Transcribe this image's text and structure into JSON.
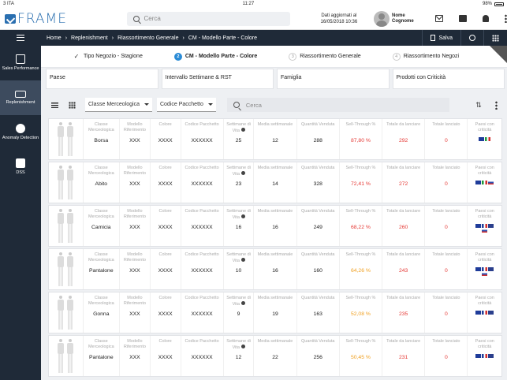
{
  "status": {
    "carrier": "3 ITA",
    "time": "11:27",
    "battery": "98%"
  },
  "header": {
    "logo": "FRAME",
    "search_placeholder": "Cerca",
    "updated_line1": "Dati aggiornati al",
    "updated_line2": "16/05/2018 10:36",
    "user_first": "Nome",
    "user_last": "Cognome"
  },
  "sidebar": {
    "items": [
      {
        "label": "Sales Performance",
        "icon": "shopping-bag-icon"
      },
      {
        "label": "Replenishment",
        "icon": "truck-icon"
      },
      {
        "label": "Anomaly Detection",
        "icon": "anomaly-icon"
      },
      {
        "label": "DSS",
        "icon": "chat-icon"
      }
    ]
  },
  "breadcrumb": {
    "items": [
      "Home",
      "Replenishment",
      "Riassortimento Generale",
      "CM - Modello Parte - Colore"
    ],
    "save_label": "Salva"
  },
  "steps": [
    {
      "num": "✓",
      "label": "Tipo Negozio - Stagione"
    },
    {
      "num": "2",
      "label": "CM - Modello Parte - Colore"
    },
    {
      "num": "3",
      "label": "Riassortimento Generale"
    },
    {
      "num": "4",
      "label": "Riassortimento Negozi"
    }
  ],
  "filters": [
    "Paese",
    "Intervallo Settimane & RST",
    "Famiglia",
    "Prodotti con Criticità"
  ],
  "toolbar": {
    "select1": "Classe Merceologica",
    "select2": "Codice Pacchetto",
    "search_placeholder": "Cerca"
  },
  "columns": [
    "Classe Merceologica",
    "Modello Riferimento",
    "Colore",
    "Codice Pacchetto",
    "Settimane di Vita",
    "Media settimanale",
    "Quantità Venduta",
    "Sell-Through %",
    "Totale da lanciare",
    "Totale lanciato",
    "Paesi con criticità"
  ],
  "rows": [
    {
      "classe": "Borsa",
      "modello": "XXX",
      "colore": "XXXX",
      "codice": "XXXXXX",
      "settimane": "25",
      "media": "12",
      "quantita": "288",
      "sell": "87,80 %",
      "sell_color": "red",
      "totale_lanciare": "292",
      "totale_lanciato": "0",
      "flags": [
        "eu",
        "it"
      ]
    },
    {
      "classe": "Abito",
      "modello": "XXX",
      "colore": "XXXX",
      "codice": "XXXXXX",
      "settimane": "23",
      "media": "14",
      "quantita": "328",
      "sell": "72,41 %",
      "sell_color": "red",
      "totale_lanciare": "272",
      "totale_lanciato": "0",
      "flags": [
        "eu",
        "it",
        "ru"
      ]
    },
    {
      "classe": "Camicia",
      "modello": "XXX",
      "colore": "XXXX",
      "codice": "XXXXXX",
      "settimane": "16",
      "media": "16",
      "quantita": "249",
      "sell": "68,22 %",
      "sell_color": "red",
      "totale_lanciare": "260",
      "totale_lanciato": "0",
      "flags": [
        "eu",
        "fr",
        "gb",
        "ru"
      ]
    },
    {
      "classe": "Pantalone",
      "modello": "XXX",
      "colore": "XXXX",
      "codice": "XXXXXX",
      "settimane": "10",
      "media": "16",
      "quantita": "160",
      "sell": "64,26 %",
      "sell_color": "orange",
      "totale_lanciare": "243",
      "totale_lanciato": "0",
      "flags": [
        "eu",
        "fr",
        "gb",
        "ru"
      ]
    },
    {
      "classe": "Gonna",
      "modello": "XXX",
      "colore": "XXXX",
      "codice": "XXXXXX",
      "settimane": "9",
      "media": "19",
      "quantita": "163",
      "sell": "52,08 %",
      "sell_color": "orange",
      "totale_lanciare": "235",
      "totale_lanciato": "0",
      "flags": [
        "eu",
        "fr",
        "gb"
      ]
    },
    {
      "classe": "Pantalone",
      "modello": "XXX",
      "colore": "XXXX",
      "codice": "XXXXXX",
      "settimane": "12",
      "media": "22",
      "quantita": "256",
      "sell": "50,45 %",
      "sell_color": "orange",
      "totale_lanciare": "231",
      "totale_lanciato": "0",
      "flags": [
        "eu",
        "fr",
        "gb"
      ]
    }
  ]
}
